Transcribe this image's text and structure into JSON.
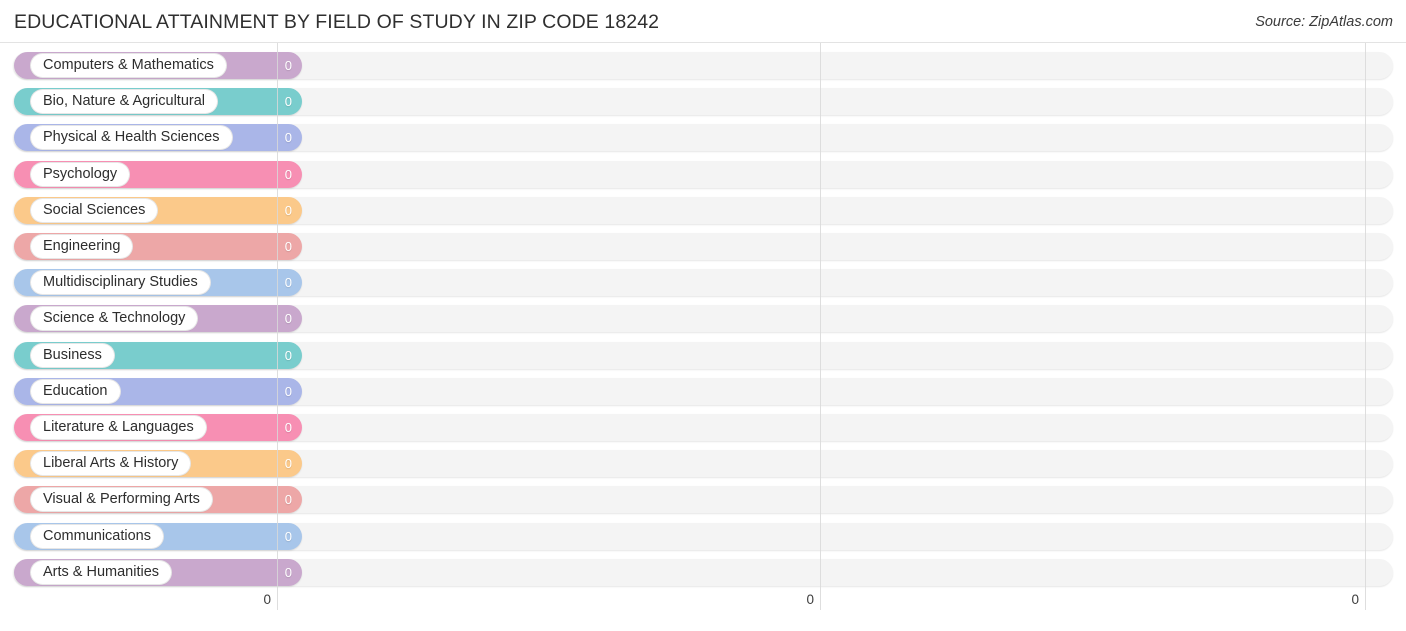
{
  "header": {
    "title": "EDUCATIONAL ATTAINMENT BY FIELD OF STUDY IN ZIP CODE 18242",
    "source": "Source: ZipAtlas.com"
  },
  "chart_data": {
    "type": "bar",
    "orientation": "horizontal",
    "title": "EDUCATIONAL ATTAINMENT BY FIELD OF STUDY IN ZIP CODE 18242",
    "xlabel": "",
    "ylabel": "",
    "xlim": [
      0,
      0
    ],
    "grid": true,
    "legend": "none",
    "axis_ticks": [
      "0",
      "0",
      "0"
    ],
    "categories": [
      "Computers & Mathematics",
      "Bio, Nature & Agricultural",
      "Physical & Health Sciences",
      "Psychology",
      "Social Sciences",
      "Engineering",
      "Multidisciplinary Studies",
      "Science & Technology",
      "Business",
      "Education",
      "Literature & Languages",
      "Liberal Arts & History",
      "Visual & Performing Arts",
      "Communications",
      "Arts & Humanities"
    ],
    "values": [
      0,
      0,
      0,
      0,
      0,
      0,
      0,
      0,
      0,
      0,
      0,
      0,
      0,
      0,
      0
    ],
    "value_labels": [
      "0",
      "0",
      "0",
      "0",
      "0",
      "0",
      "0",
      "0",
      "0",
      "0",
      "0",
      "0",
      "0",
      "0",
      "0"
    ],
    "colors": [
      "#c9a8cd",
      "#79cdcd",
      "#aab6e8",
      "#f78fb3",
      "#fbc98a",
      "#eda7a7",
      "#a8c6ea",
      "#c9a8cd",
      "#79cdcd",
      "#aab6e8",
      "#f78fb3",
      "#fbc98a",
      "#eda7a7",
      "#a8c6ea",
      "#c9a8cd"
    ]
  }
}
